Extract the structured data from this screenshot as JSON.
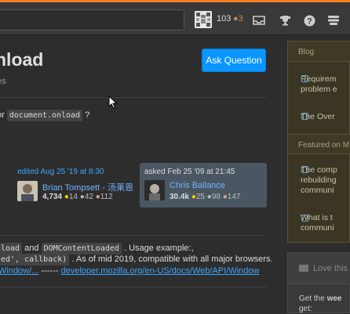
{
  "topbar": {
    "reputation": "103",
    "bronze_badges": "●3",
    "icons": [
      "inbox-icon",
      "trophy-icon",
      "help-icon",
      "menu-icon"
    ]
  },
  "question": {
    "title_fragment": "nload",
    "subinfo_fragment": "es",
    "ask_button": "Ask Question",
    "body_prefix": "or",
    "body_code": "document.onload",
    "body_suffix": "?"
  },
  "edit_card": {
    "meta": "edited Aug 25 '19 at 8:30",
    "user": "Brian Tompsett - 汤莱恩",
    "rep": "4,734",
    "gold": "14",
    "silver": "42",
    "bronze": "112"
  },
  "ask_card": {
    "meta": "asked Feb 25 '09 at 21:45",
    "user": "Chris Ballance",
    "rep": "30.4k",
    "gold": "25",
    "silver": "98",
    "bronze": "147"
  },
  "answer": {
    "line1_code1": "load",
    "line1_and": "and",
    "line1_code2": "DOMContentLoaded",
    "line1_rest": ". Usage example:,",
    "line2_code": "ed', callback)",
    "line2_rest": ". As of mid 2019, compatible with all major browsers.",
    "line3_link1": "Window/...",
    "line3_sep": "------",
    "line3_link2": "developer.mozilla.org/en-US/docs/Web/API/Window"
  },
  "sidebar": {
    "blog_header": "Blog",
    "blog_items": [
      "Requirem problem e",
      "The Over"
    ],
    "featured_header": "Featured on M",
    "featured_items": [
      "The comp rebuilding communi",
      "What is t communi"
    ],
    "love_title": "Love this",
    "love_body_line1": "Get the",
    "love_body_bold": "wee",
    "love_body_line2": "get:"
  },
  "colors": {
    "accent": "#f48024",
    "button": "#0a95ff",
    "link": "#3fa6ff"
  }
}
